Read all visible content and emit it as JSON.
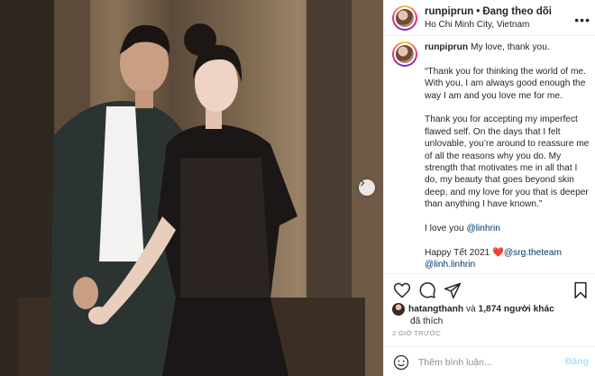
{
  "post": {
    "username": "runpiprun",
    "separator": "•",
    "follow_label": "Đang theo dõi",
    "location": "Ho Chi Minh City, Vietnam",
    "more_icon": "more-horizontal-icon"
  },
  "caption": {
    "username": "runpiprun",
    "first_line": "My love, thank you.",
    "paragraphs": [
      "“Thank you for thinking the world of me. With you, I am always good enough the way I am and you love me for me.",
      "Thank you for accepting my imperfect flawed self. On the days that I felt unlovable, you’re around to reassure me of all the reasons why you do. My strength that motivates me in all that I do, my beauty that goes beyond skin deep, and my love for you that is deeper than anything I have known.”"
    ],
    "love_prefix": "I love you ",
    "love_mention": "@linhrin",
    "happy_text": "Happy Tết 2021 ",
    "heart_emoji": "❤️",
    "team_mention": "@srg.theteam",
    "last_mention": "@linh.linhrin"
  },
  "actions": {
    "like_icon": "heart-icon",
    "comment_icon": "comment-icon",
    "share_icon": "share-icon",
    "save_icon": "bookmark-icon"
  },
  "likes": {
    "liker": "hatangthanh",
    "and_text": " và ",
    "others": "1,874 người khác",
    "suffix": "đã thích"
  },
  "timestamp": "2 GIỜ TRƯỚC",
  "comment": {
    "placeholder": "Thêm bình luận...",
    "post_label": "Đăng",
    "emoji_icon": "emoji-icon"
  },
  "colors": {
    "link": "#00376b",
    "post_disabled": "#b2dffc",
    "muted": "#8e8e8e"
  }
}
